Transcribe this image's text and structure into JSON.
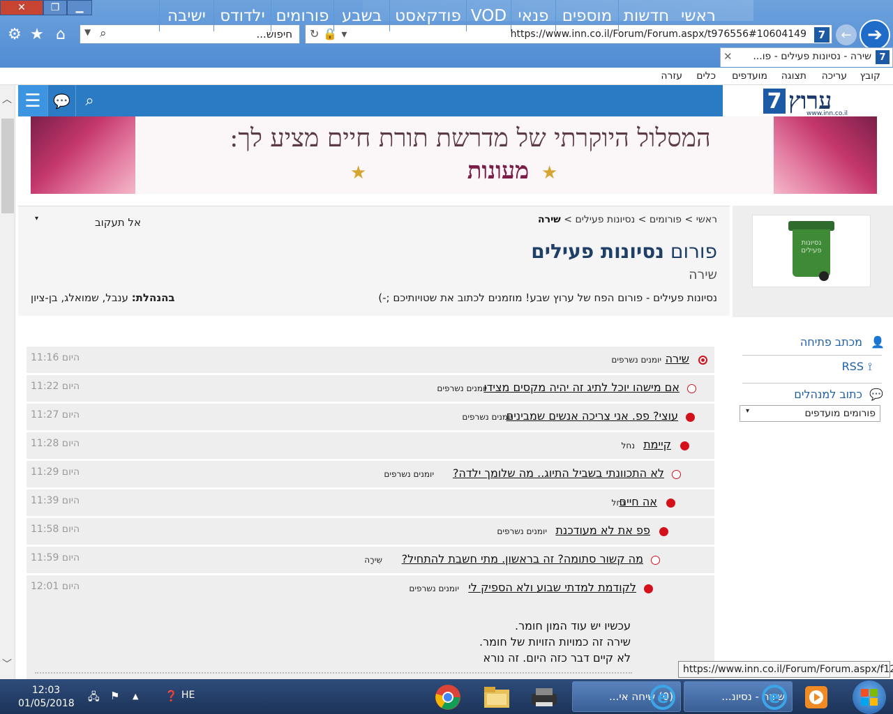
{
  "window": {
    "close_glyph": "✕",
    "restore_glyph": "❐",
    "min_glyph": "▁"
  },
  "toolbar": {
    "search_placeholder": "חיפוש...",
    "address_url": "https://www.inn.co.il/Forum/Forum.aspx/t976556#10604149",
    "site_icon_text": "7"
  },
  "tab": {
    "title": "שירה - נסיונות פעילים - פו...",
    "icon_text": "7"
  },
  "menubar": [
    "קובץ",
    "עריכה",
    "תצוגה",
    "מועדפים",
    "כלים",
    "עזרה"
  ],
  "site": {
    "logo_number": "7",
    "logo_name": "ערוץ",
    "logo_url": "www.inn.co.il",
    "nav": [
      "ראשי",
      "חדשות",
      "מוספים",
      "פנאי",
      "VOD",
      "פודקאסט",
      "בשבע",
      "פורומים",
      "ילדודס",
      "ישיבה"
    ]
  },
  "banner": {
    "headline": "המסלול היוקרתי של מדרשת תורת חיים מציע לך:",
    "sub": "מעונות"
  },
  "forum": {
    "breadcrumb": [
      "ראשי",
      "פורומים",
      "נסיונות פעילים",
      "שירה"
    ],
    "follow_label": "אל תעקוב",
    "title_prefix": "פורום",
    "title_name": "נסיונות פעילים",
    "subtitle": "שירה",
    "description": "נסיונות פעילים - פורום הפח של ערוץ שבע! מוזמנים לכתוב את שטויותיכם ;-)",
    "mods_label": "בהנהלת:",
    "mods_names": "ענבל, שמואלג, בן-ציון",
    "bin_text": "נסיונות פעילים"
  },
  "sidebar": {
    "welcome_letter": "מכתב פתיחה",
    "rss": "RSS",
    "write_to_admins": "כתוב למנהלים",
    "favorites_select": "פורומים מועדפים"
  },
  "threads": [
    {
      "subject": "שירה",
      "author": "יומנים נשרפים",
      "time": "היום 11:16",
      "marker": "ring"
    },
    {
      "subject": "אם מישהו יוכל לתיג זה יהיה מקסים מצידו",
      "author": "יומנים נשרפים",
      "time": "היום 11:22",
      "marker": "hollow"
    },
    {
      "subject": "עוצי? פפ. אני צריכה אנשים שמבינים",
      "author": "יומנים נשרפים",
      "time": "היום 11:27",
      "marker": "filled"
    },
    {
      "subject": "קיימת",
      "author": "נחל",
      "time": "היום 11:28",
      "marker": "filled"
    },
    {
      "subject": "לא התכוונתי בשביל התיוג.. מה שלומך ילדה?",
      "author": "יומנים נשרפים",
      "time": "היום 11:29",
      "marker": "hollow"
    },
    {
      "subject": "אה חיים",
      "author": "נחל",
      "time": "היום 11:39",
      "marker": "filled"
    },
    {
      "subject": "פפ את לא מעודכנת",
      "author": "יומנים נשרפים",
      "time": "היום 11:58",
      "marker": "filled"
    },
    {
      "subject": "מה קשור סתומה? זה בראשון. מתי חשבת להתחיל?",
      "author": "שִירָה",
      "time": "היום 11:59",
      "marker": "hollow"
    },
    {
      "subject": "לקודמת למדתי שבוע ולא הספיק לי",
      "author": "יומנים נשרפים",
      "time": "היום 12:01",
      "marker": "filled"
    }
  ],
  "post_body": [
    "עכשיו יש עוד המון חומר.",
    "שירה זה כמויות הזויות של חומר.",
    "לא קיים דבר כזה היום. זה נורא"
  ],
  "status_url": "https://www.inn.co.il/Forum/Forum.aspx/f12",
  "taskbar": {
    "time": "12:03",
    "date": "01/05/2018",
    "lang": "HE",
    "task1": "שירה - נסיונ...",
    "task2": "(0) שיחה אי..."
  },
  "colors": {
    "nav_blue": "#2b7bc4",
    "link_blue": "#1f5fa8",
    "marker_red": "#d4111a"
  }
}
